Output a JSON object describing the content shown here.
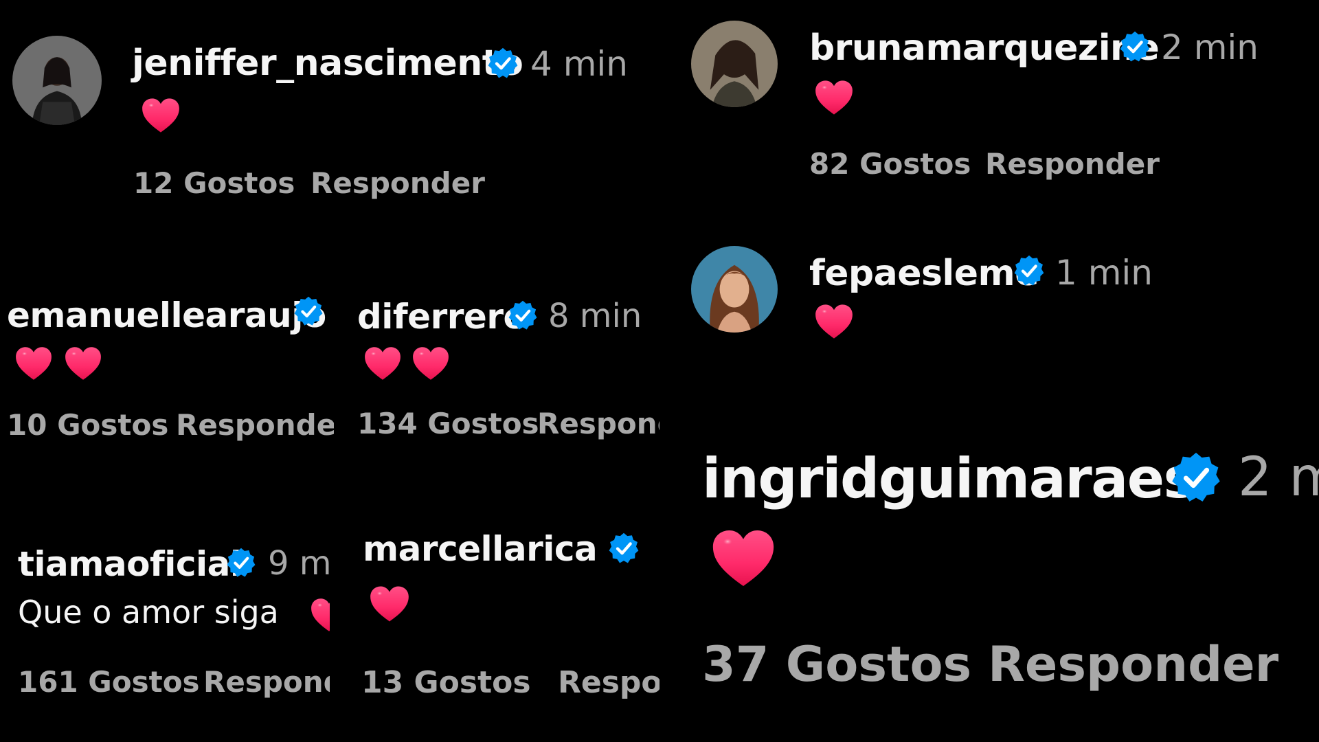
{
  "colors": {
    "background": "#000000",
    "username": "#f5f5f5",
    "meta": "#a8a8a8",
    "verified": "#0095f6",
    "heart": "#ff2d6b"
  },
  "icons": {
    "verified": "verified-badge-icon",
    "heart": "heart-emoji-icon"
  },
  "comments": [
    {
      "username": "jeniffer_nascimento",
      "time": "4 min",
      "text": "",
      "hearts": 1,
      "likes": "12 Gostos",
      "reply": "Responder"
    },
    {
      "username": "brunamarquezine",
      "time": "2 min",
      "text": "",
      "hearts": 1,
      "likes": "82 Gostos",
      "reply": "Responder"
    },
    {
      "username": "emanuellearaujo",
      "time": "",
      "text": "",
      "hearts": 2,
      "likes": "10 Gostos",
      "reply": "Responder"
    },
    {
      "username": "diferrero",
      "time": "8 min",
      "text": "",
      "hearts": 2,
      "likes": "134 Gostos",
      "reply": "Respond"
    },
    {
      "username": "fepaesleme",
      "time": "1 min",
      "text": "",
      "hearts": 1,
      "likes": "",
      "reply": ""
    },
    {
      "username": "ingridguimaraes",
      "time": "2 m",
      "text": "",
      "hearts": 1,
      "likes": "37 Gostos",
      "reply": "Responder"
    },
    {
      "username": "tiamaoficial",
      "time": "9 m",
      "text": "Que o amor siga",
      "hearts": 1,
      "likes": "161 Gostos",
      "reply": "Respond"
    },
    {
      "username": "marcellarica",
      "time": "",
      "text": "",
      "hearts": 1,
      "likes": "13 Gostos",
      "reply": "Respo"
    }
  ]
}
